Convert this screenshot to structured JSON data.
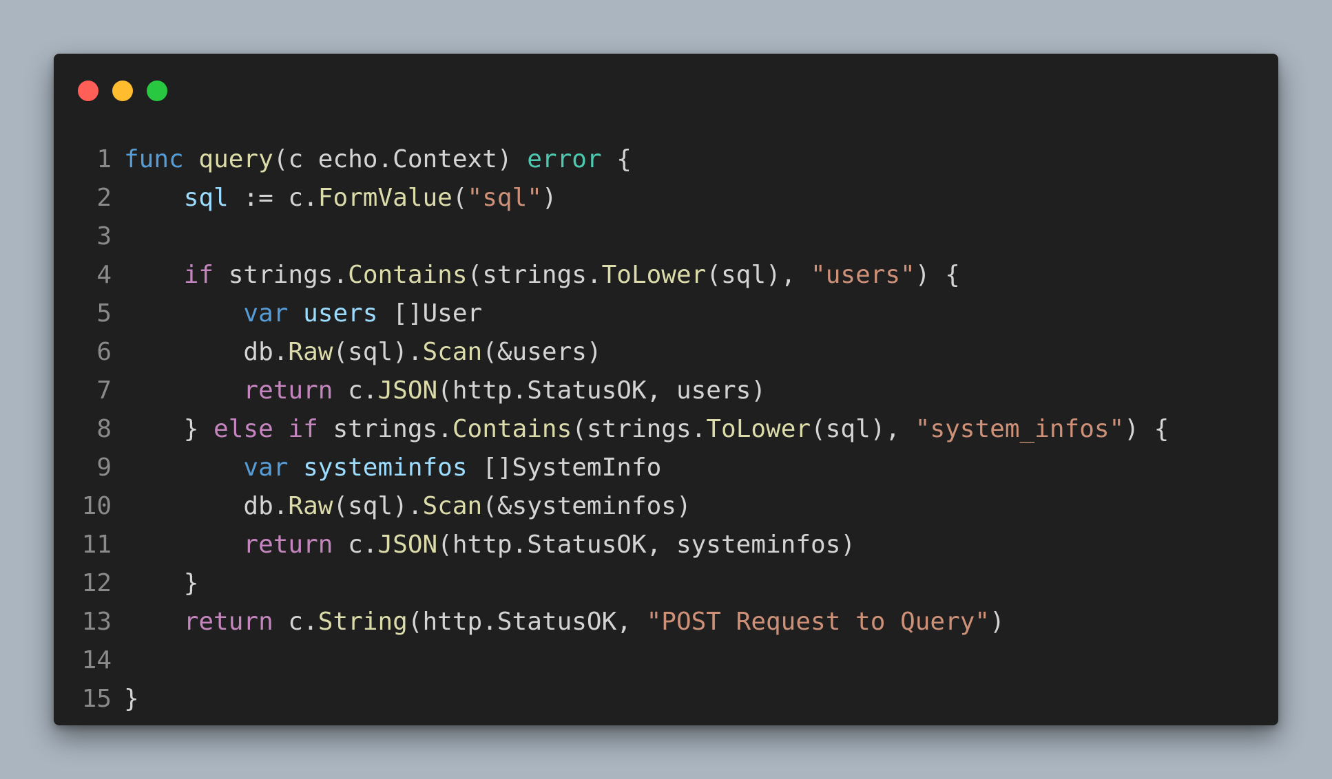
{
  "window": {
    "traffic_lights": [
      {
        "name": "close",
        "color": "#ff5f57"
      },
      {
        "name": "minimize",
        "color": "#febc2e"
      },
      {
        "name": "maximize",
        "color": "#28c840"
      }
    ]
  },
  "theme": {
    "keyword": "#569cd6",
    "control": "#c586c0",
    "function": "#dcdcaa",
    "variable": "#9cdcfe",
    "type": "#4ec9b0",
    "string": "#ce9178",
    "plain": "#d4d4d4",
    "line_number": "#8a8a8a",
    "background": "#1f1f1f"
  },
  "code": {
    "language": "go",
    "lines": [
      {
        "number": "1",
        "tokens": [
          {
            "t": "kw",
            "v": "func"
          },
          {
            "t": "plain",
            "v": " "
          },
          {
            "t": "fn",
            "v": "query"
          },
          {
            "t": "plain",
            "v": "(c echo.Context) "
          },
          {
            "t": "type",
            "v": "error"
          },
          {
            "t": "plain",
            "v": " {"
          }
        ]
      },
      {
        "number": "2",
        "tokens": [
          {
            "t": "plain",
            "v": "    "
          },
          {
            "t": "var",
            "v": "sql"
          },
          {
            "t": "plain",
            "v": " := c."
          },
          {
            "t": "fn",
            "v": "FormValue"
          },
          {
            "t": "plain",
            "v": "("
          },
          {
            "t": "str",
            "v": "\"sql\""
          },
          {
            "t": "plain",
            "v": ")"
          }
        ]
      },
      {
        "number": "3",
        "tokens": []
      },
      {
        "number": "4",
        "tokens": [
          {
            "t": "plain",
            "v": "    "
          },
          {
            "t": "ctrl",
            "v": "if"
          },
          {
            "t": "plain",
            "v": " strings."
          },
          {
            "t": "fn",
            "v": "Contains"
          },
          {
            "t": "plain",
            "v": "(strings."
          },
          {
            "t": "fn",
            "v": "ToLower"
          },
          {
            "t": "plain",
            "v": "(sql), "
          },
          {
            "t": "str",
            "v": "\"users\""
          },
          {
            "t": "plain",
            "v": ") {"
          }
        ]
      },
      {
        "number": "5",
        "tokens": [
          {
            "t": "plain",
            "v": "        "
          },
          {
            "t": "kw",
            "v": "var"
          },
          {
            "t": "plain",
            "v": " "
          },
          {
            "t": "var",
            "v": "users"
          },
          {
            "t": "plain",
            "v": " []User"
          }
        ]
      },
      {
        "number": "6",
        "tokens": [
          {
            "t": "plain",
            "v": "        db."
          },
          {
            "t": "fn",
            "v": "Raw"
          },
          {
            "t": "plain",
            "v": "(sql)."
          },
          {
            "t": "fn",
            "v": "Scan"
          },
          {
            "t": "plain",
            "v": "(&users)"
          }
        ]
      },
      {
        "number": "7",
        "tokens": [
          {
            "t": "plain",
            "v": "        "
          },
          {
            "t": "ctrl",
            "v": "return"
          },
          {
            "t": "plain",
            "v": " c."
          },
          {
            "t": "fn",
            "v": "JSON"
          },
          {
            "t": "plain",
            "v": "(http.StatusOK, users)"
          }
        ]
      },
      {
        "number": "8",
        "tokens": [
          {
            "t": "plain",
            "v": "    } "
          },
          {
            "t": "ctrl",
            "v": "else"
          },
          {
            "t": "plain",
            "v": " "
          },
          {
            "t": "ctrl",
            "v": "if"
          },
          {
            "t": "plain",
            "v": " strings."
          },
          {
            "t": "fn",
            "v": "Contains"
          },
          {
            "t": "plain",
            "v": "(strings."
          },
          {
            "t": "fn",
            "v": "ToLower"
          },
          {
            "t": "plain",
            "v": "(sql), "
          },
          {
            "t": "str",
            "v": "\"system_infos\""
          },
          {
            "t": "plain",
            "v": ") {"
          }
        ]
      },
      {
        "number": "9",
        "tokens": [
          {
            "t": "plain",
            "v": "        "
          },
          {
            "t": "kw",
            "v": "var"
          },
          {
            "t": "plain",
            "v": " "
          },
          {
            "t": "var",
            "v": "systeminfos"
          },
          {
            "t": "plain",
            "v": " []SystemInfo"
          }
        ]
      },
      {
        "number": "10",
        "tokens": [
          {
            "t": "plain",
            "v": "        db."
          },
          {
            "t": "fn",
            "v": "Raw"
          },
          {
            "t": "plain",
            "v": "(sql)."
          },
          {
            "t": "fn",
            "v": "Scan"
          },
          {
            "t": "plain",
            "v": "(&systeminfos)"
          }
        ]
      },
      {
        "number": "11",
        "tokens": [
          {
            "t": "plain",
            "v": "        "
          },
          {
            "t": "ctrl",
            "v": "return"
          },
          {
            "t": "plain",
            "v": " c."
          },
          {
            "t": "fn",
            "v": "JSON"
          },
          {
            "t": "plain",
            "v": "(http.StatusOK, systeminfos)"
          }
        ]
      },
      {
        "number": "12",
        "tokens": [
          {
            "t": "plain",
            "v": "    }"
          }
        ]
      },
      {
        "number": "13",
        "tokens": [
          {
            "t": "plain",
            "v": "    "
          },
          {
            "t": "ctrl",
            "v": "return"
          },
          {
            "t": "plain",
            "v": " c."
          },
          {
            "t": "fn",
            "v": "String"
          },
          {
            "t": "plain",
            "v": "(http.StatusOK, "
          },
          {
            "t": "str",
            "v": "\"POST Request to Query\""
          },
          {
            "t": "plain",
            "v": ")"
          }
        ]
      },
      {
        "number": "14",
        "tokens": []
      },
      {
        "number": "15",
        "tokens": [
          {
            "t": "plain",
            "v": "}"
          }
        ]
      }
    ]
  }
}
